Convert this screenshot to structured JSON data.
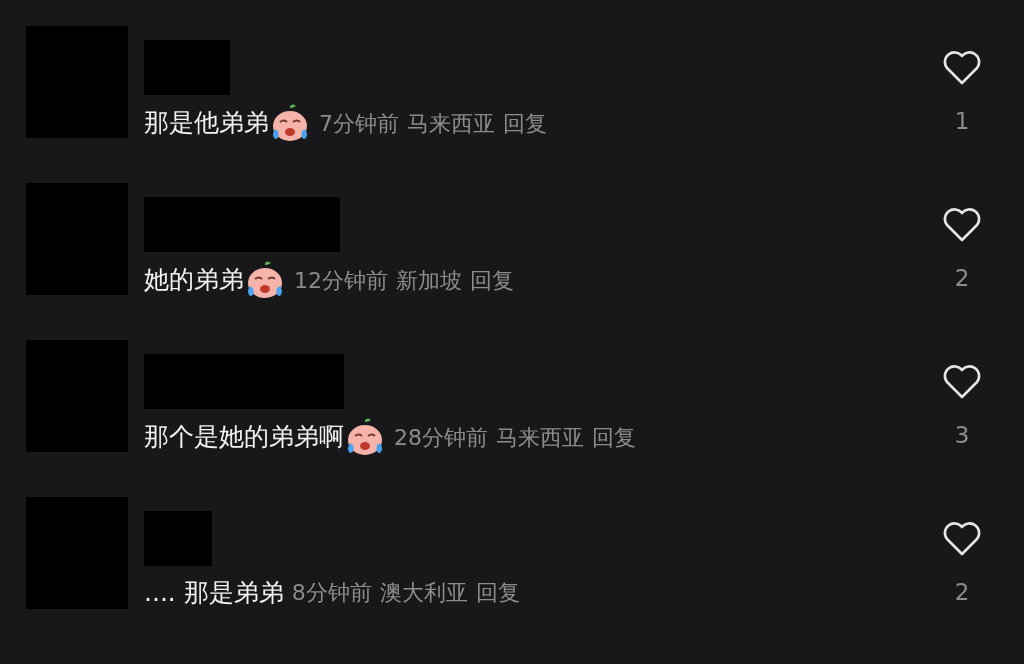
{
  "comments": [
    {
      "text": "那是他弟弟",
      "emoji": true,
      "time": "7分钟前",
      "location": "马来西亚",
      "reply": "回复",
      "likes": "1",
      "liked": false
    },
    {
      "text": "她的弟弟",
      "emoji": true,
      "time": "12分钟前",
      "location": "新加坡",
      "reply": "回复",
      "likes": "2",
      "liked": false
    },
    {
      "text": "那个是她的弟弟啊",
      "emoji": true,
      "time": "28分钟前",
      "location": "马来西亚",
      "reply": "回复",
      "likes": "3",
      "liked": false
    },
    {
      "text": ".... 那是弟弟",
      "emoji": false,
      "time": "8分钟前",
      "location": "澳大利亚",
      "reply": "回复",
      "likes": "2",
      "liked": false
    }
  ]
}
